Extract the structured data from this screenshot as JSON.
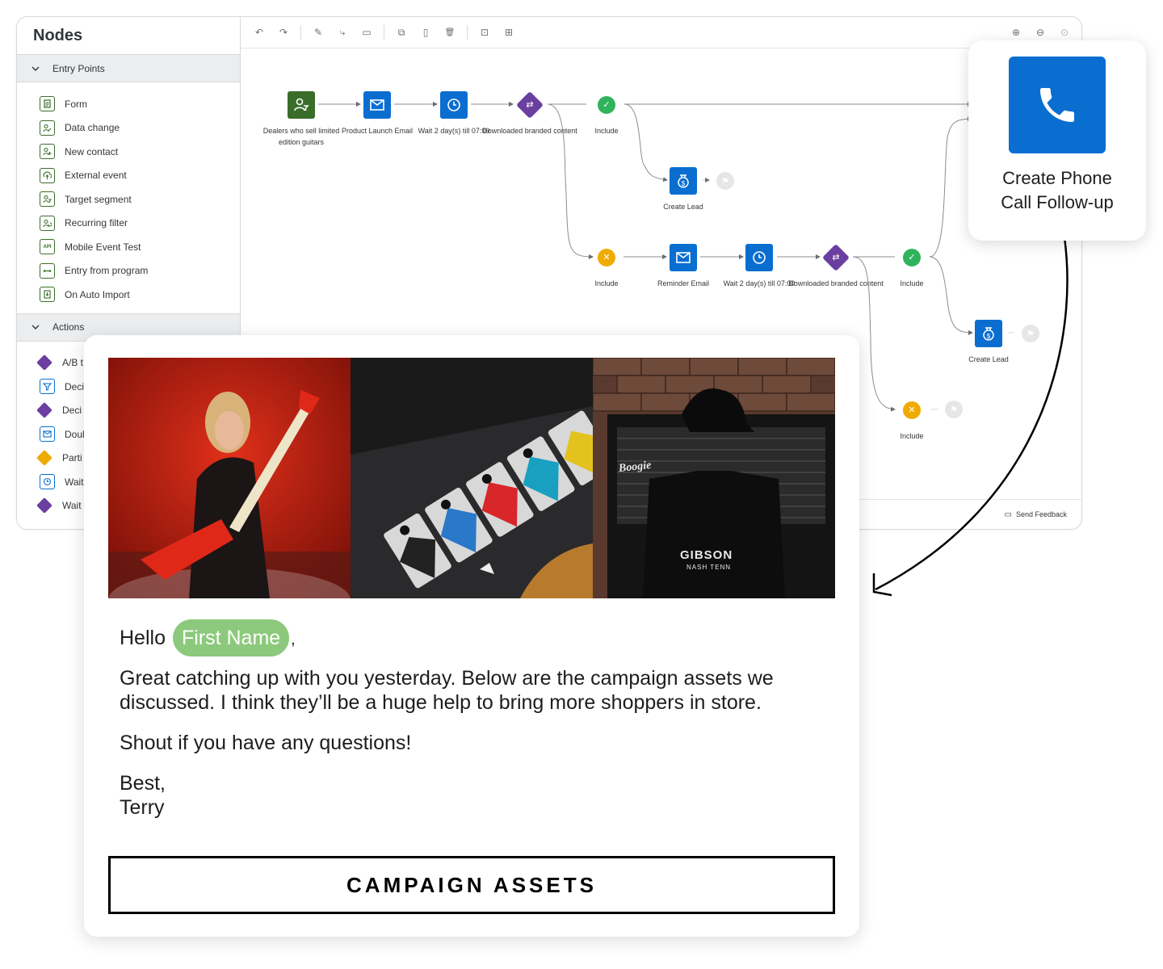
{
  "sidebar": {
    "title": "Nodes",
    "sections": [
      {
        "label": "Entry Points"
      },
      {
        "label": "Actions"
      }
    ],
    "entry_points": [
      {
        "label": "Form",
        "icon": "form-icon"
      },
      {
        "label": "Data change",
        "icon": "data-change-icon"
      },
      {
        "label": "New contact",
        "icon": "new-contact-icon"
      },
      {
        "label": "External event",
        "icon": "external-event-icon"
      },
      {
        "label": "Target segment",
        "icon": "target-segment-icon"
      },
      {
        "label": "Recurring filter",
        "icon": "recurring-filter-icon"
      },
      {
        "label": "Mobile Event Test",
        "icon": "api-icon"
      },
      {
        "label": "Entry from program",
        "icon": "entry-program-icon"
      },
      {
        "label": "On Auto Import",
        "icon": "import-icon"
      }
    ],
    "actions": [
      {
        "label": "A/B t"
      },
      {
        "label": "Deci"
      },
      {
        "label": "Deci"
      },
      {
        "label": "Doul"
      },
      {
        "label": "Parti"
      },
      {
        "label": "Wait"
      },
      {
        "label": "Wait"
      }
    ]
  },
  "toolbar": {
    "undo": "↶",
    "redo": "↷",
    "edit": "✎",
    "connect": "⤷",
    "comment": "▭",
    "copy": "⧉",
    "paste": "▯",
    "delete": "🗑",
    "fit": "⊡",
    "expand": "⊞",
    "zoom_in": "⊕",
    "zoom_out": "⊖",
    "zoom_reset": "⊙"
  },
  "flow": {
    "n1": "Dealers who sell limited edition guitars",
    "n2": "Product Launch Email",
    "n3": "Wait 2 day(s) till 07:00",
    "n4": "Downloaded branded content",
    "n5": "Include",
    "n6": "Create Lead",
    "n7": "Include",
    "n8": "Reminder Email",
    "n9": "Wait 2 day(s) till 07:00",
    "n10": "Downloaded branded content",
    "n11": "Include",
    "n12": "Create Lead",
    "n13": "Include"
  },
  "footer": {
    "feedback": "Send Feedback"
  },
  "callcard": {
    "line1": "Create Phone",
    "line2": "Call Follow-up"
  },
  "email": {
    "greeting": "Hello",
    "name_chip": "First Name",
    "comma": ",",
    "p1": "Great catching up with you yesterday. Below are the campaign assets we discussed. I think they’ll be a huge help to bring more shoppers in store.",
    "p2": "Shout if you have any questions!",
    "signoff": "Best,",
    "signature": "Terry",
    "cta": "CAMPAIGN ASSETS",
    "img3_text1": "Boogie",
    "img3_text2": "GIBSON",
    "img3_text3": "NASH TENN"
  },
  "colors": {
    "accent": "#0a6ed1",
    "green": "#3a6d2a",
    "purple": "#6b3fa0",
    "ok": "#2fb35d",
    "warn": "#f0ab00",
    "chip": "#8cc97c"
  }
}
